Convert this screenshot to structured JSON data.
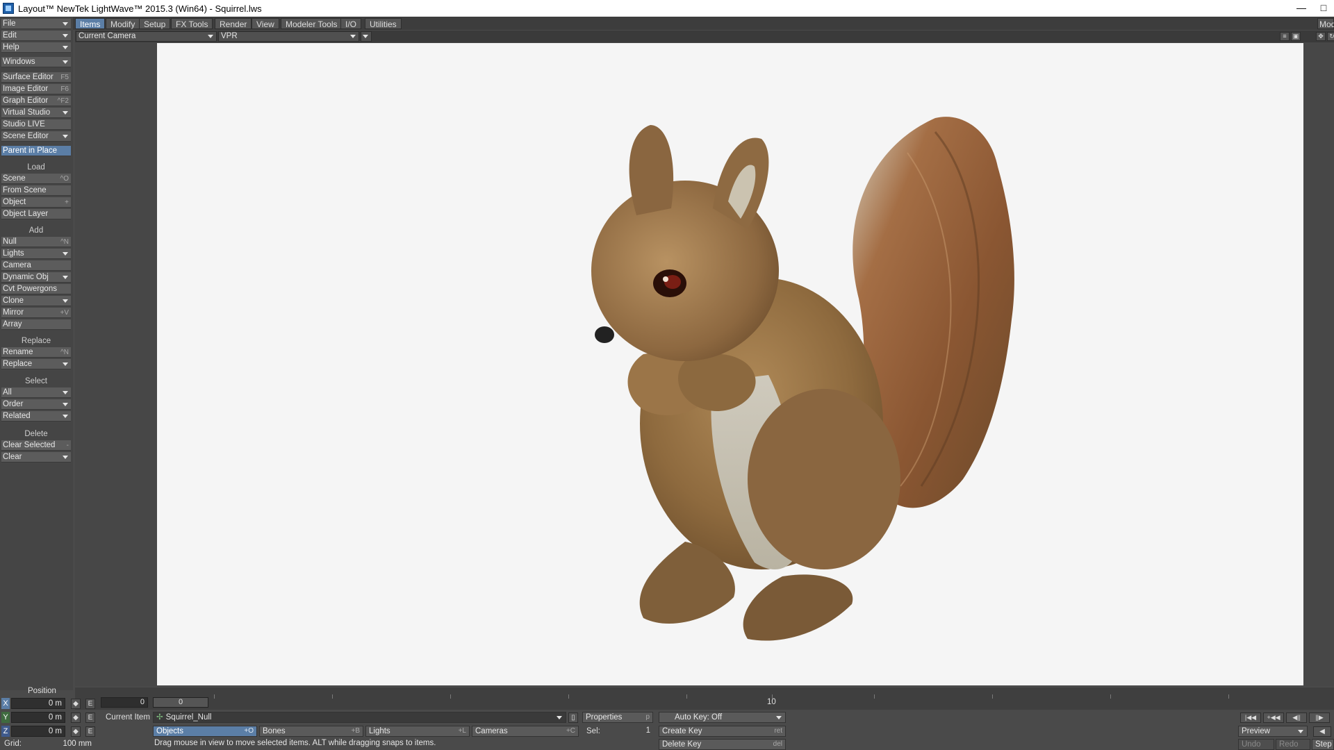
{
  "window": {
    "title": "Layout™ NewTek LightWave™ 2015.3 (Win64) - Squirrel.lws",
    "minimize": "—",
    "maximize": "□"
  },
  "tabs": [
    {
      "label": "Items",
      "active": true
    },
    {
      "label": "Modify"
    },
    {
      "label": "Setup"
    },
    {
      "label": "FX Tools"
    },
    {
      "label": "Render"
    },
    {
      "label": "View"
    },
    {
      "label": "Modeler Tools"
    },
    {
      "label": "I/O"
    },
    {
      "label": "Utilities"
    }
  ],
  "modeler_label": "Mod",
  "left_menu": {
    "file": "File",
    "edit": "Edit",
    "help": "Help",
    "windows": "Windows",
    "surface_editor": {
      "label": "Surface Editor",
      "shortcut": "F5"
    },
    "image_editor": {
      "label": "Image Editor",
      "shortcut": "F6"
    },
    "graph_editor": {
      "label": "Graph Editor",
      "shortcut": "^F2"
    },
    "virtual_studio": "Virtual Studio",
    "studio_live": "Studio LIVE",
    "scene_editor": "Scene Editor",
    "parent_in_place": "Parent in Place",
    "load_header": "Load",
    "scene": {
      "label": "Scene",
      "shortcut": "^O"
    },
    "from_scene": "From Scene",
    "object": {
      "label": "Object",
      "shortcut": "+"
    },
    "object_layer": "Object Layer",
    "add_header": "Add",
    "null": {
      "label": "Null",
      "shortcut": "^N"
    },
    "lights": "Lights",
    "camera": "Camera",
    "dynamic_obj": "Dynamic Obj",
    "cvt_powergons": "Cvt Powergons",
    "clone": "Clone",
    "mirror": {
      "label": "Mirror",
      "shortcut": "+V"
    },
    "array": "Array",
    "replace_header": "Replace",
    "rename": {
      "label": "Rename",
      "shortcut": "^N"
    },
    "replace": "Replace",
    "select_header": "Select",
    "all": "All",
    "order": "Order",
    "related": "Related",
    "delete_header": "Delete",
    "clear_selected": {
      "label": "Clear Selected",
      "shortcut": "-"
    },
    "clear": "Clear"
  },
  "viewport": {
    "camera_select": "Current Camera",
    "render_mode": "VPR"
  },
  "timeline": {
    "start_frame": "0",
    "current_frame": "0",
    "tick_label": "10"
  },
  "position": {
    "header": "Position",
    "x_axis": "X",
    "y_axis": "Y",
    "z_axis": "Z",
    "x": "0 m",
    "y": "0 m",
    "z": "0 m",
    "env": "E",
    "grid_label": "Grid:",
    "grid_value": "100 mm"
  },
  "current_item": {
    "label": "Current Item",
    "value": "Squirrel_Null"
  },
  "item_types": {
    "objects": {
      "label": "Objects",
      "shortcut": "+O"
    },
    "bones": {
      "label": "Bones",
      "shortcut": "+B"
    },
    "lights": {
      "label": "Lights",
      "shortcut": "+L"
    },
    "cameras": {
      "label": "Cameras",
      "shortcut": "+C"
    }
  },
  "properties": {
    "label": "Properties",
    "shortcut": "p"
  },
  "sel": {
    "label": "Sel:",
    "value": "1"
  },
  "auto_key": "Auto Key: Off",
  "create_key": {
    "label": "Create Key",
    "shortcut": "ret"
  },
  "delete_key": {
    "label": "Delete Key",
    "shortcut": "del"
  },
  "preview": "Preview",
  "undo": "Undo",
  "redo": "Redo",
  "step": "Step",
  "status_message": "Drag mouse in view to move selected items. ALT while dragging snaps to items."
}
